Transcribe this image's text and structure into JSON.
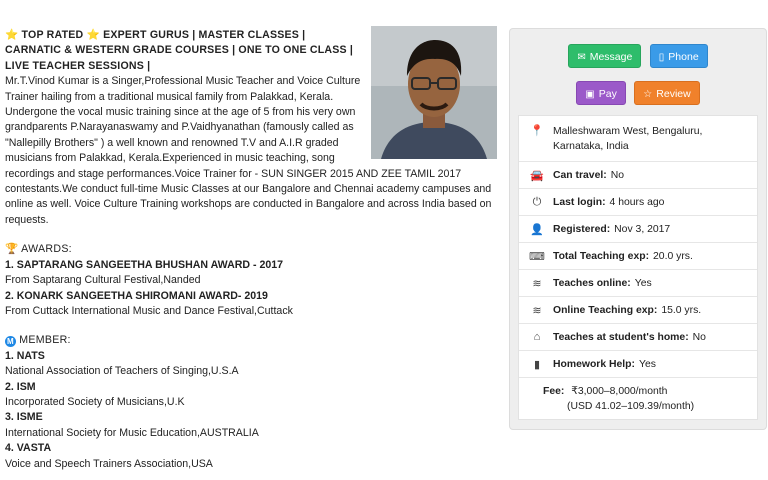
{
  "profile": {
    "headline_prefix": "TOP RATED",
    "headline_rest": "EXPERT GURUS | MASTER CLASSES | CARNATIC & WESTERN GRADE COURSES | ONE TO ONE CLASS | LIVE TEACHER SESSIONS |",
    "bio": "Mr.T.Vinod Kumar is a Singer,Professional Music Teacher and Voice Culture Trainer hailing from a traditional musical family from Palakkad, Kerala. Undergone the vocal music training since at the age of 5 from his very own grandparents P.Narayanaswamy and P.Vaidhyanathan (famously called as \"Nallepilly Brothers\" ) a well known and renowned T.V and A.I.R graded musicians from Palakkad, Kerala.Experienced in music teaching, song recordings and stage performances.Voice Trainer for - SUN SINGER 2015 AND ZEE TAMIL 2017 contestants.We conduct full-time Music Classes at our Bangalore and Chennai academy campuses and online as well. Voice Culture Training workshops are conducted in Bangalore and across India based on requests."
  },
  "awards": {
    "title": "AWARDS:",
    "items": [
      {
        "name": "1. SAPTARANG SANGEETHA BHUSHAN AWARD - 2017",
        "from": "From Saptarang Cultural Festival,Nanded"
      },
      {
        "name": "2. KONARK SANGEETHA SHIROMANI AWARD- 2019",
        "from": "From Cuttack International Music and Dance Festival,Cuttack"
      }
    ]
  },
  "member": {
    "title": "MEMBER:",
    "badge": "M",
    "items": [
      {
        "name": "1. NATS",
        "desc": "National Association of Teachers of Singing,U.S.A"
      },
      {
        "name": "2. ISM",
        "desc": "Incorporated Society of Musicians,U.K"
      },
      {
        "name": "3. ISME",
        "desc": "International Society for Music Education,AUSTRALIA"
      },
      {
        "name": "4. VASTA",
        "desc": "Voice and Speech Trainers Association,USA"
      }
    ]
  },
  "actions": {
    "message": "Message",
    "phone": "Phone",
    "pay": "Pay",
    "review": "Review"
  },
  "details": {
    "location": "Malleshwaram West, Bengaluru, Karnataka, India",
    "can_travel_label": "Can travel:",
    "can_travel": "No",
    "last_login_label": "Last login:",
    "last_login": "4 hours ago",
    "registered_label": "Registered:",
    "registered": "Nov 3, 2017",
    "teaching_exp_label": "Total Teaching exp:",
    "teaching_exp": "20.0 yrs.",
    "teaches_online_label": "Teaches online:",
    "teaches_online": "Yes",
    "online_exp_label": "Online Teaching exp:",
    "online_exp": "15.0 yrs.",
    "home_label": "Teaches at student's home:",
    "home": "No",
    "homework_label": "Homework Help:",
    "homework": "Yes",
    "fee_label": "Fee:",
    "fee": "₹3,000–8,000/month",
    "fee_usd": "(USD 41.02–109.39/month)"
  },
  "colors": {
    "message": "#2ebd6b",
    "phone": "#3a9be8",
    "pay": "#9b59c9",
    "review": "#f0812b",
    "location_pin": "#1e88e5"
  }
}
